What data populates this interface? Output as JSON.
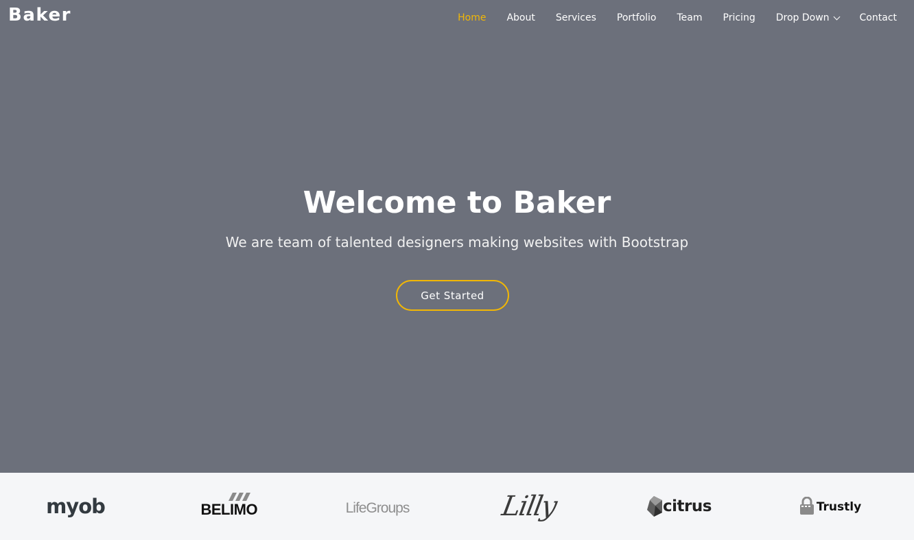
{
  "header": {
    "brand": "Baker",
    "nav": [
      {
        "label": "Home",
        "active": true
      },
      {
        "label": "About"
      },
      {
        "label": "Services"
      },
      {
        "label": "Portfolio"
      },
      {
        "label": "Team"
      },
      {
        "label": "Pricing"
      },
      {
        "label": "Drop Down",
        "icon": "chevron-down-icon"
      },
      {
        "label": "Contact"
      }
    ]
  },
  "hero": {
    "title": "Welcome to Baker",
    "subtitle": "We are team of talented designers making websites with Bootstrap",
    "cta_label": "Get Started"
  },
  "clients": [
    {
      "name": "myob"
    },
    {
      "name": "BELIMO"
    },
    {
      "name": "LifeGroups"
    },
    {
      "name": "Lilly"
    },
    {
      "name": "citrus"
    },
    {
      "name": "Trustly"
    }
  ],
  "colors": {
    "hero_bg": "#6c707b",
    "accent": "#f2b705",
    "clients_bg": "#f5f6f8"
  }
}
